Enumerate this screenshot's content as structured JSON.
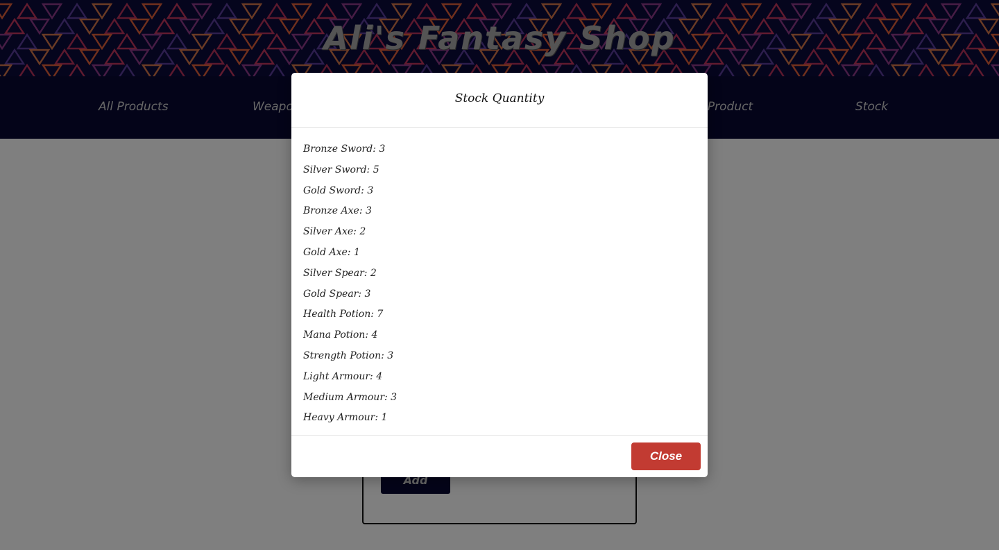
{
  "header": {
    "title": "Ali's Fantasy Shop"
  },
  "nav": {
    "items": [
      {
        "label": "All Products"
      },
      {
        "label": "Weapons"
      },
      {
        "label": "Buy Product"
      },
      {
        "label": "Stock"
      }
    ]
  },
  "form": {
    "add_label": "Add"
  },
  "modal": {
    "title": "Stock Quantity",
    "items": [
      "Bronze Sword: 3",
      "Silver Sword: 5",
      "Gold Sword: 3",
      "Bronze Axe: 3",
      "Silver Axe: 2",
      "Gold Axe: 1",
      "Silver Spear: 2",
      "Gold Spear: 3",
      "Health Potion: 7",
      "Mana Potion: 4",
      "Strength Potion: 3",
      "Light Armour: 4",
      "Medium Armour: 3",
      "Heavy Armour: 1"
    ],
    "close_label": "Close"
  },
  "colors": {
    "header_bg": "#0b0b3b",
    "nav_bg": "#090933",
    "close_button": "#c23b32",
    "overlay": "rgba(0,0,0,0.5)"
  }
}
